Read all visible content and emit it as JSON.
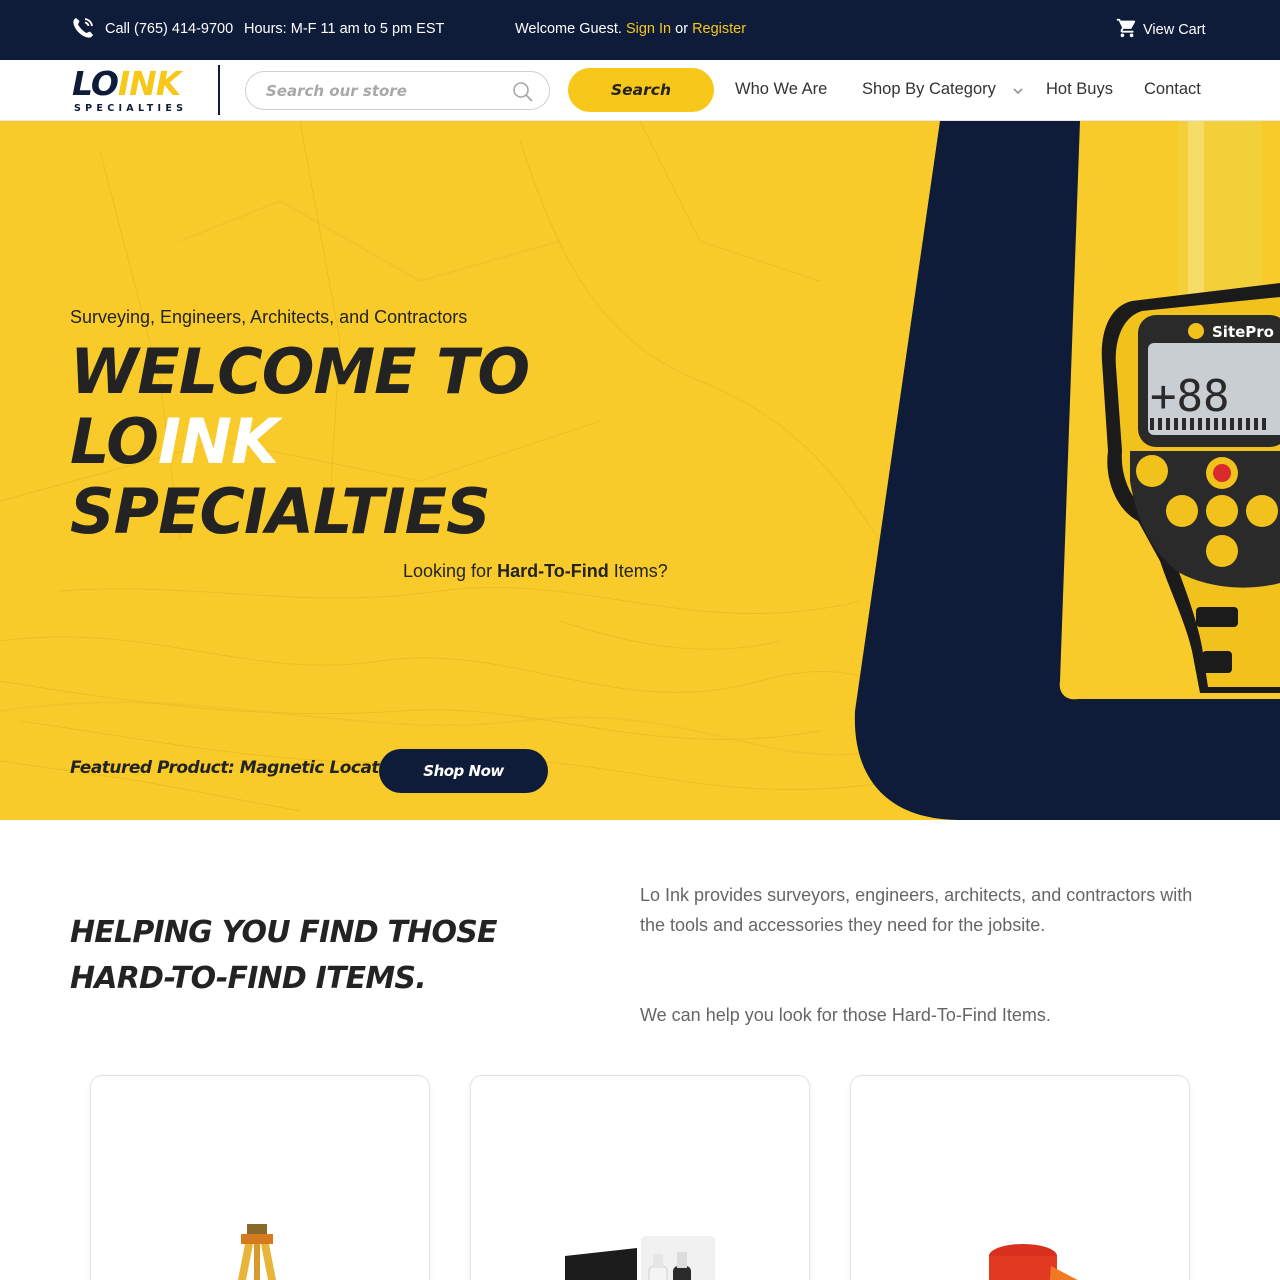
{
  "topbar": {
    "call": "Call (765) 414-9700",
    "hours": "Hours: M-F 11 am to 5 pm EST",
    "welcome": "Welcome Guest.",
    "sign_in": "Sign In",
    "or": "or",
    "register": "Register",
    "cart": "View Cart",
    "icons": [
      "phone-icon",
      "cart-icon"
    ]
  },
  "brand": {
    "logo_lo": "LO",
    "logo_ink": "INK",
    "logo_sub": "SPECIALTIES",
    "colors": {
      "navy": "#0e1c39",
      "yellow": "#f7c71a",
      "hero_yellow": "#f8cb2a"
    }
  },
  "search": {
    "placeholder": "Search our store",
    "button": "Search"
  },
  "nav": {
    "who": "Who We Are",
    "shop": "Shop By Category",
    "hot": "Hot Buys",
    "contact": "Contact"
  },
  "hero": {
    "kicker": "Surveying, Engineers, Architects, and Contractors",
    "title_line1": "WELCOME TO",
    "title_lo": "LO",
    "title_ink": "INK",
    "title_line3": "SPECIALTIES",
    "looking_prefix": "Looking for",
    "looking_bold": "Hard-To-Find",
    "looking_suffix": "Items?",
    "featured": "Featured Product: Magnetic Locator",
    "shop_now": "Shop Now",
    "device_brand": "SitePro",
    "device_readout": "+88"
  },
  "intro": {
    "heading": "HELPING YOU FIND THOSE HARD-TO-FIND ITEMS.",
    "p1": "Lo Ink provides surveyors, engineers, architects, and contractors with the tools and accessories they need for the jobsite.",
    "p2": "We can help you look for those Hard-To-Find Items."
  }
}
